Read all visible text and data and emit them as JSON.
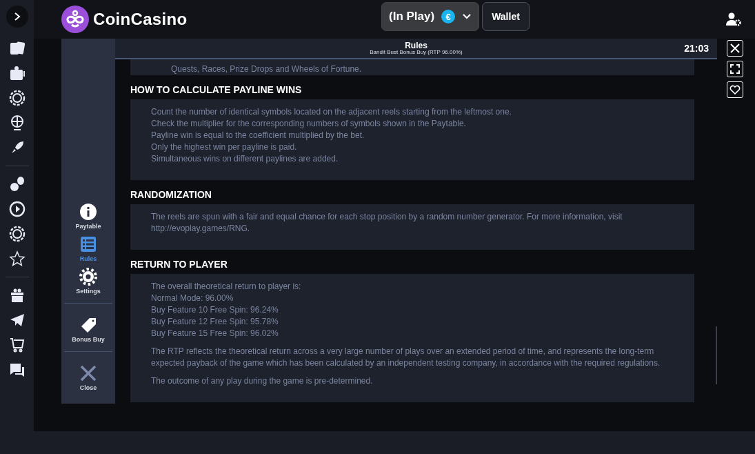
{
  "header": {
    "logo_text": "CoinCasino",
    "balance_label": "(In Play)",
    "currency_symbol": "€",
    "wallet_button": "Wallet"
  },
  "game_menu": {
    "items": [
      {
        "label": "Paytable",
        "kind": "info",
        "selected": false
      },
      {
        "label": "Rules",
        "kind": "list",
        "selected": true
      },
      {
        "label": "Settings",
        "kind": "gear",
        "selected": false
      },
      {
        "label": "Bonus Buy",
        "kind": "tag",
        "selected": false
      },
      {
        "label": "Close",
        "kind": "close",
        "selected": false
      }
    ]
  },
  "rules": {
    "title": "Rules",
    "subtitle": "Bandit Bust Bonus Buy (RTP 96.00%)",
    "clock": "21:03",
    "top_fragment": "Quests, Races, Prize Drops and Wheels of Fortune.",
    "sections": [
      {
        "heading": "HOW TO CALCULATE PAYLINE WINS",
        "paragraphs": [
          [
            "Count the number of identical symbols located on the adjacent reels starting from the leftmost one.",
            "Check the multiplier for the corresponding numbers of symbols shown in the Paytable.",
            "Payline win is equal to the coefficient multiplied by the bet.",
            "Only the highest win per payline is paid.",
            "Simultaneous wins on different paylines are added."
          ]
        ]
      },
      {
        "heading": "RANDOMIZATION",
        "paragraphs": [
          [
            "The reels are spun with a fair and equal chance for each stop position by a random number generator. For more information, visit http://evoplay.games/RNG."
          ]
        ]
      },
      {
        "heading": "RETURN TO PLAYER",
        "paragraphs": [
          [
            "The overall theoretical return to player is:",
            "Normal Mode: 96.00%",
            "Buy Feature 10 Free Spin: 96.24%",
            "Buy Feature 12 Free Spin: 95.78%",
            "Buy Feature 15 Free Spin: 96.02%"
          ],
          [
            "The RTP reflects the theoretical return across a very large number of plays over an extended period of time, and represents the long-term expected payback of the game which has been calculated by an independent testing company, in accordance with the required regulations."
          ],
          [
            "The outcome of any play during the game is pre-determined."
          ]
        ]
      }
    ]
  }
}
